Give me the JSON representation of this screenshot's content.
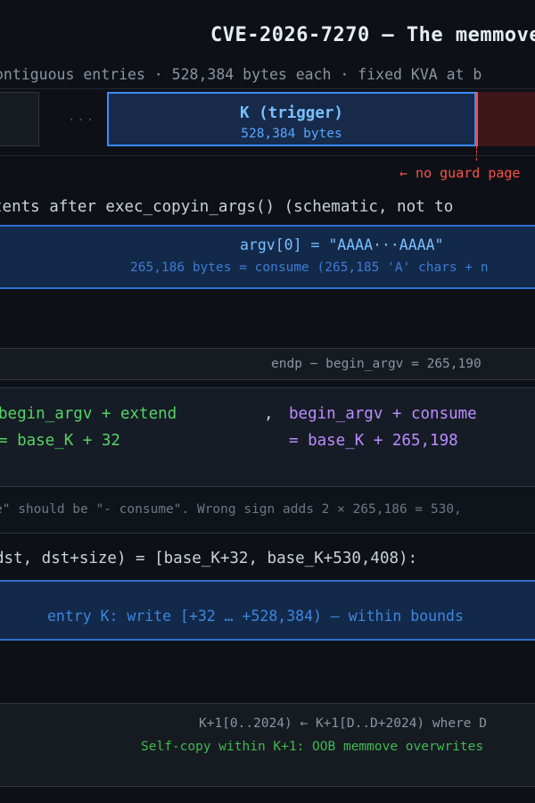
{
  "header": {
    "title": "CVE-2026-7270 — The memmove",
    "subtitle": "ontiguous entries · 528,384 bytes each · fixed KVA at b"
  },
  "kva_row": {
    "ellipsis": "...",
    "trigger_label": "K (trigger)",
    "trigger_size": "528,384 bytes",
    "guard_note": "← no guard page"
  },
  "args_section": {
    "heading": "tents after exec_copyin_args() (schematic, not to",
    "argv_line": "argv[0] = \"AAAA···AAAA\"",
    "argv_size": "265,186 bytes = consume (265,185 'A' chars + n"
  },
  "endp": {
    "text": "endp − begin_argv = 265,190"
  },
  "dst_calc": {
    "left_expr": "begin_argv + extend",
    "left_value": "= base_K + 32",
    "separator": ",",
    "right_expr": "begin_argv + consume",
    "right_value": "= base_K + 265,198"
  },
  "bug_note": {
    "text": "e\" should be \"- consume\". Wrong sign adds 2 × 265,186 = 530,"
  },
  "range": {
    "text": "dst, dst+size) = [base_K+32, base_K+530,408):"
  },
  "write_entry": {
    "text": "entry K: write [+32 … +528,384) — within bounds"
  },
  "k1_copy": {
    "line1": "K+1[0..2024) ← K+1[D..D+2024) where D",
    "line2": "Self-copy within K+1: OOB memmove overwrites"
  },
  "colors": {
    "background": "#0d1117",
    "trigger_blue": "#388bfd",
    "guard_red": "#f85149",
    "extend_green": "#56d364",
    "consume_purple": "#bc8cff"
  }
}
